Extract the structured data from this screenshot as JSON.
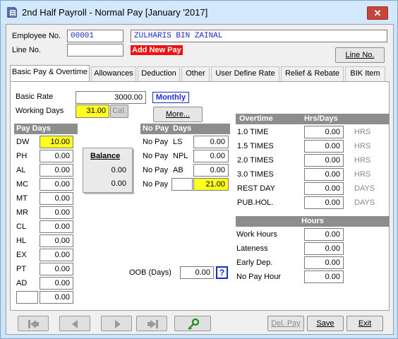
{
  "window": {
    "title": "2nd Half Payroll - Normal Pay [January '2017]",
    "close_glyph": "✕"
  },
  "header": {
    "employee_no_label": "Employee No.",
    "employee_no_value": "00001",
    "employee_name": "ZULHARIS BIN ZAINAL",
    "line_no_label": "Line No.",
    "line_no_value": "",
    "add_new_pay_label": "Add New Pay",
    "line_no_button": "Line No."
  },
  "tabs": [
    {
      "label": "Basic Pay & Overtime"
    },
    {
      "label": "Allowances"
    },
    {
      "label": "Deduction"
    },
    {
      "label": "Other"
    },
    {
      "label": "User Define Rate"
    },
    {
      "label": "Relief & Rebate"
    },
    {
      "label": "BIK Item"
    }
  ],
  "basic": {
    "basic_rate_label": "Basic Rate",
    "basic_rate_value": "3000.00",
    "pay_type": "Monthly",
    "working_days_label": "Working Days",
    "working_days_value": "31.00",
    "cal_button": "Cal.",
    "more_button": "More..."
  },
  "pay_days": {
    "header": "Pay Days",
    "items": [
      {
        "code": "DW",
        "value": "10.00"
      },
      {
        "code": "PH",
        "value": "0.00"
      },
      {
        "code": "AL",
        "value": "0.00"
      },
      {
        "code": "MC",
        "value": "0.00"
      },
      {
        "code": "MT",
        "value": "0.00"
      },
      {
        "code": "MR",
        "value": "0.00"
      },
      {
        "code": "CL",
        "value": "0.00"
      },
      {
        "code": "HL",
        "value": "0.00"
      },
      {
        "code": "EX",
        "value": "0.00"
      },
      {
        "code": "PT",
        "value": "0.00"
      },
      {
        "code": "AD",
        "value": "0.00"
      },
      {
        "code": "",
        "value": "0.00"
      }
    ]
  },
  "balance": {
    "title": "Balance",
    "value1": "0.00",
    "value2": "0.00"
  },
  "no_pay": {
    "header_left": "No Pay",
    "header_right": "Days",
    "items": [
      {
        "prefix": "No Pay",
        "code": "LS",
        "value": "0.00"
      },
      {
        "prefix": "No Pay",
        "code": "NPL",
        "value": "0.00"
      },
      {
        "prefix": "No Pay",
        "code": "AB",
        "value": "0.00"
      },
      {
        "prefix": "No Pay",
        "code": "",
        "value": "21.00"
      }
    ]
  },
  "oob": {
    "label": "OOB (Days)",
    "value": "0.00",
    "help": "?"
  },
  "overtime": {
    "header_left": "Overtime",
    "header_right": "Hrs/Days",
    "items": [
      {
        "label": "1.0 TIME",
        "value": "0.00",
        "unit": "HRS"
      },
      {
        "label": "1.5 TIMES",
        "value": "0.00",
        "unit": "HRS"
      },
      {
        "label": "2.0 TIMES",
        "value": "0.00",
        "unit": "HRS"
      },
      {
        "label": "3.0 TIMES",
        "value": "0.00",
        "unit": "HRS"
      },
      {
        "label": "REST DAY",
        "value": "0.00",
        "unit": "DAYS"
      },
      {
        "label": "PUB.HOL.",
        "value": "0.00",
        "unit": "DAYS"
      }
    ]
  },
  "hours": {
    "header": "Hours",
    "items": [
      {
        "label": "Work Hours",
        "value": "0.00"
      },
      {
        "label": "Lateness",
        "value": "0.00"
      },
      {
        "label": "Early Dep.",
        "value": "0.00"
      },
      {
        "label": "No Pay Hour",
        "value": "0.00"
      }
    ]
  },
  "footer": {
    "del_pay": "Del. Pay",
    "save": "Save",
    "exit": "Exit"
  }
}
